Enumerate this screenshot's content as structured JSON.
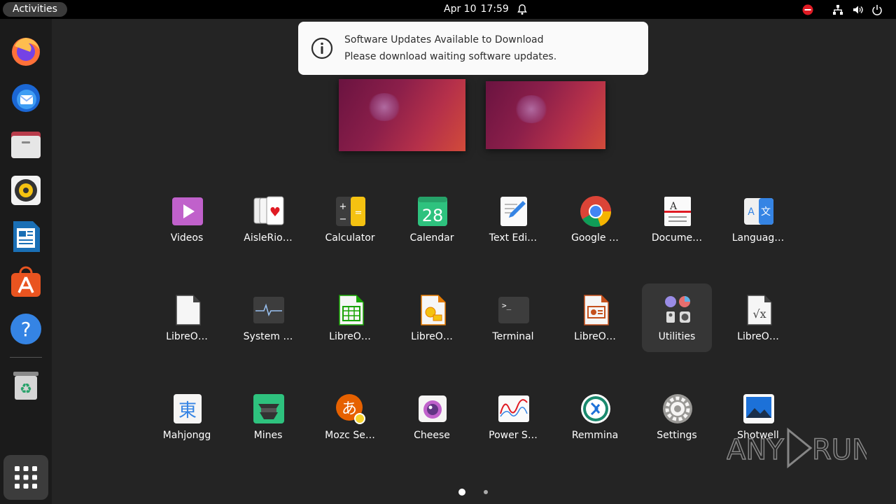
{
  "topbar": {
    "activities": "Activities",
    "date": "Apr 10",
    "time": "17:59"
  },
  "notification": {
    "title": "Software Updates Available to Download",
    "body": "Please download waiting software updates."
  },
  "apps": [
    {
      "label": "Videos",
      "icon": "videos-icon"
    },
    {
      "label": "AisleRio…",
      "icon": "aisleriot-icon"
    },
    {
      "label": "Calculator",
      "icon": "calculator-icon"
    },
    {
      "label": "Calendar",
      "icon": "calendar-icon",
      "badge": "28"
    },
    {
      "label": "Text Edi…",
      "icon": "text-editor-icon"
    },
    {
      "label": "Google …",
      "icon": "chrome-icon"
    },
    {
      "label": "Docume…",
      "icon": "document-viewer-icon"
    },
    {
      "label": "Languag…",
      "icon": "language-icon",
      "glyphs": "A 文"
    },
    {
      "label": "LibreO…",
      "icon": "libreoffice-icon"
    },
    {
      "label": "System …",
      "icon": "system-monitor-icon"
    },
    {
      "label": "LibreO…",
      "icon": "libreoffice-calc-icon"
    },
    {
      "label": "LibreO…",
      "icon": "libreoffice-draw-icon"
    },
    {
      "label": "Terminal",
      "icon": "terminal-icon",
      "glyphs": ">_"
    },
    {
      "label": "LibreO…",
      "icon": "libreoffice-impress-icon"
    },
    {
      "label": "Utilities",
      "icon": "utilities-folder-icon"
    },
    {
      "label": "LibreO…",
      "icon": "libreoffice-math-icon",
      "glyphs": "√x"
    },
    {
      "label": "Mahjongg",
      "icon": "mahjongg-icon",
      "glyphs": "東"
    },
    {
      "label": "Mines",
      "icon": "mines-icon"
    },
    {
      "label": "Mozc Se…",
      "icon": "mozc-icon",
      "glyphs": "あ"
    },
    {
      "label": "Cheese",
      "icon": "cheese-icon"
    },
    {
      "label": "Power S…",
      "icon": "power-statistics-icon"
    },
    {
      "label": "Remmina",
      "icon": "remmina-icon"
    },
    {
      "label": "Settings",
      "icon": "settings-icon"
    },
    {
      "label": "Shotwell",
      "icon": "shotwell-icon"
    }
  ],
  "dock": [
    "firefox-icon",
    "thunderbird-icon",
    "files-icon",
    "rhythmbox-icon",
    "writer-icon",
    "app-center-icon",
    "help-icon",
    "trash-icon",
    "show-apps-icon"
  ],
  "pages": {
    "count": 2,
    "current": 1
  },
  "watermark": "ANY RUN",
  "colors": {
    "notification_bg": "#fafafa",
    "topbar_bg": "#000000",
    "dock_bg": "#1b1b1b",
    "grid_bg": "#242424",
    "accent": "#e95420"
  }
}
